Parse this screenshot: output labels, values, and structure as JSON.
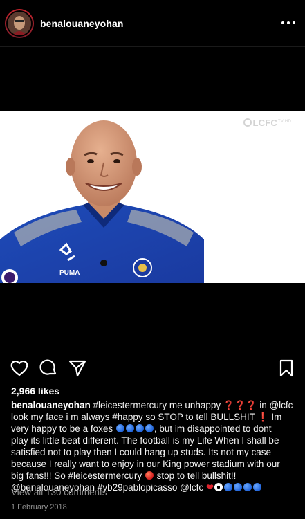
{
  "post": {
    "username": "benalouaneyohan",
    "media": {
      "watermark": "LCFC",
      "watermark_suffix": "TV HD"
    },
    "likes": "2,966 likes",
    "caption": {
      "username": "benalouaneyohan",
      "l1a": "#leicestermercury me unhappy",
      "l1b": " in @lcfc",
      "l2a": "look my face i m always #happy so STOP to tell BULLSHIT",
      "l2b": " Im",
      "l3a": "very happy to be a foxes ",
      "l3b": ", but im disappointed to dont",
      "l4": "play its little beat different. The football is my Life  When I shall be",
      "l5": "satisfied not to play then I could hang up studs. Its not my case",
      "l6": "because I really want to enjoy in our King power stadium with our",
      "l7a": "big fans!!! So #leicestermercury ",
      "l7b": " stop to tell bullshit!!",
      "l8": "@benalouaneyohan #yb29pablopicasso @lcfc "
    },
    "view_comments": "View all 130 comments",
    "date": "1 February 2018"
  },
  "icons": {
    "like": "heart-icon",
    "comment": "comment-icon",
    "share": "send-icon",
    "save": "bookmark-icon",
    "more": "more-options-icon"
  },
  "colors": {
    "background": "#000000",
    "secondary_text": "#8e8e8e",
    "avatar_ring": "#c8232c",
    "kit_blue": "#1a3fa6"
  }
}
